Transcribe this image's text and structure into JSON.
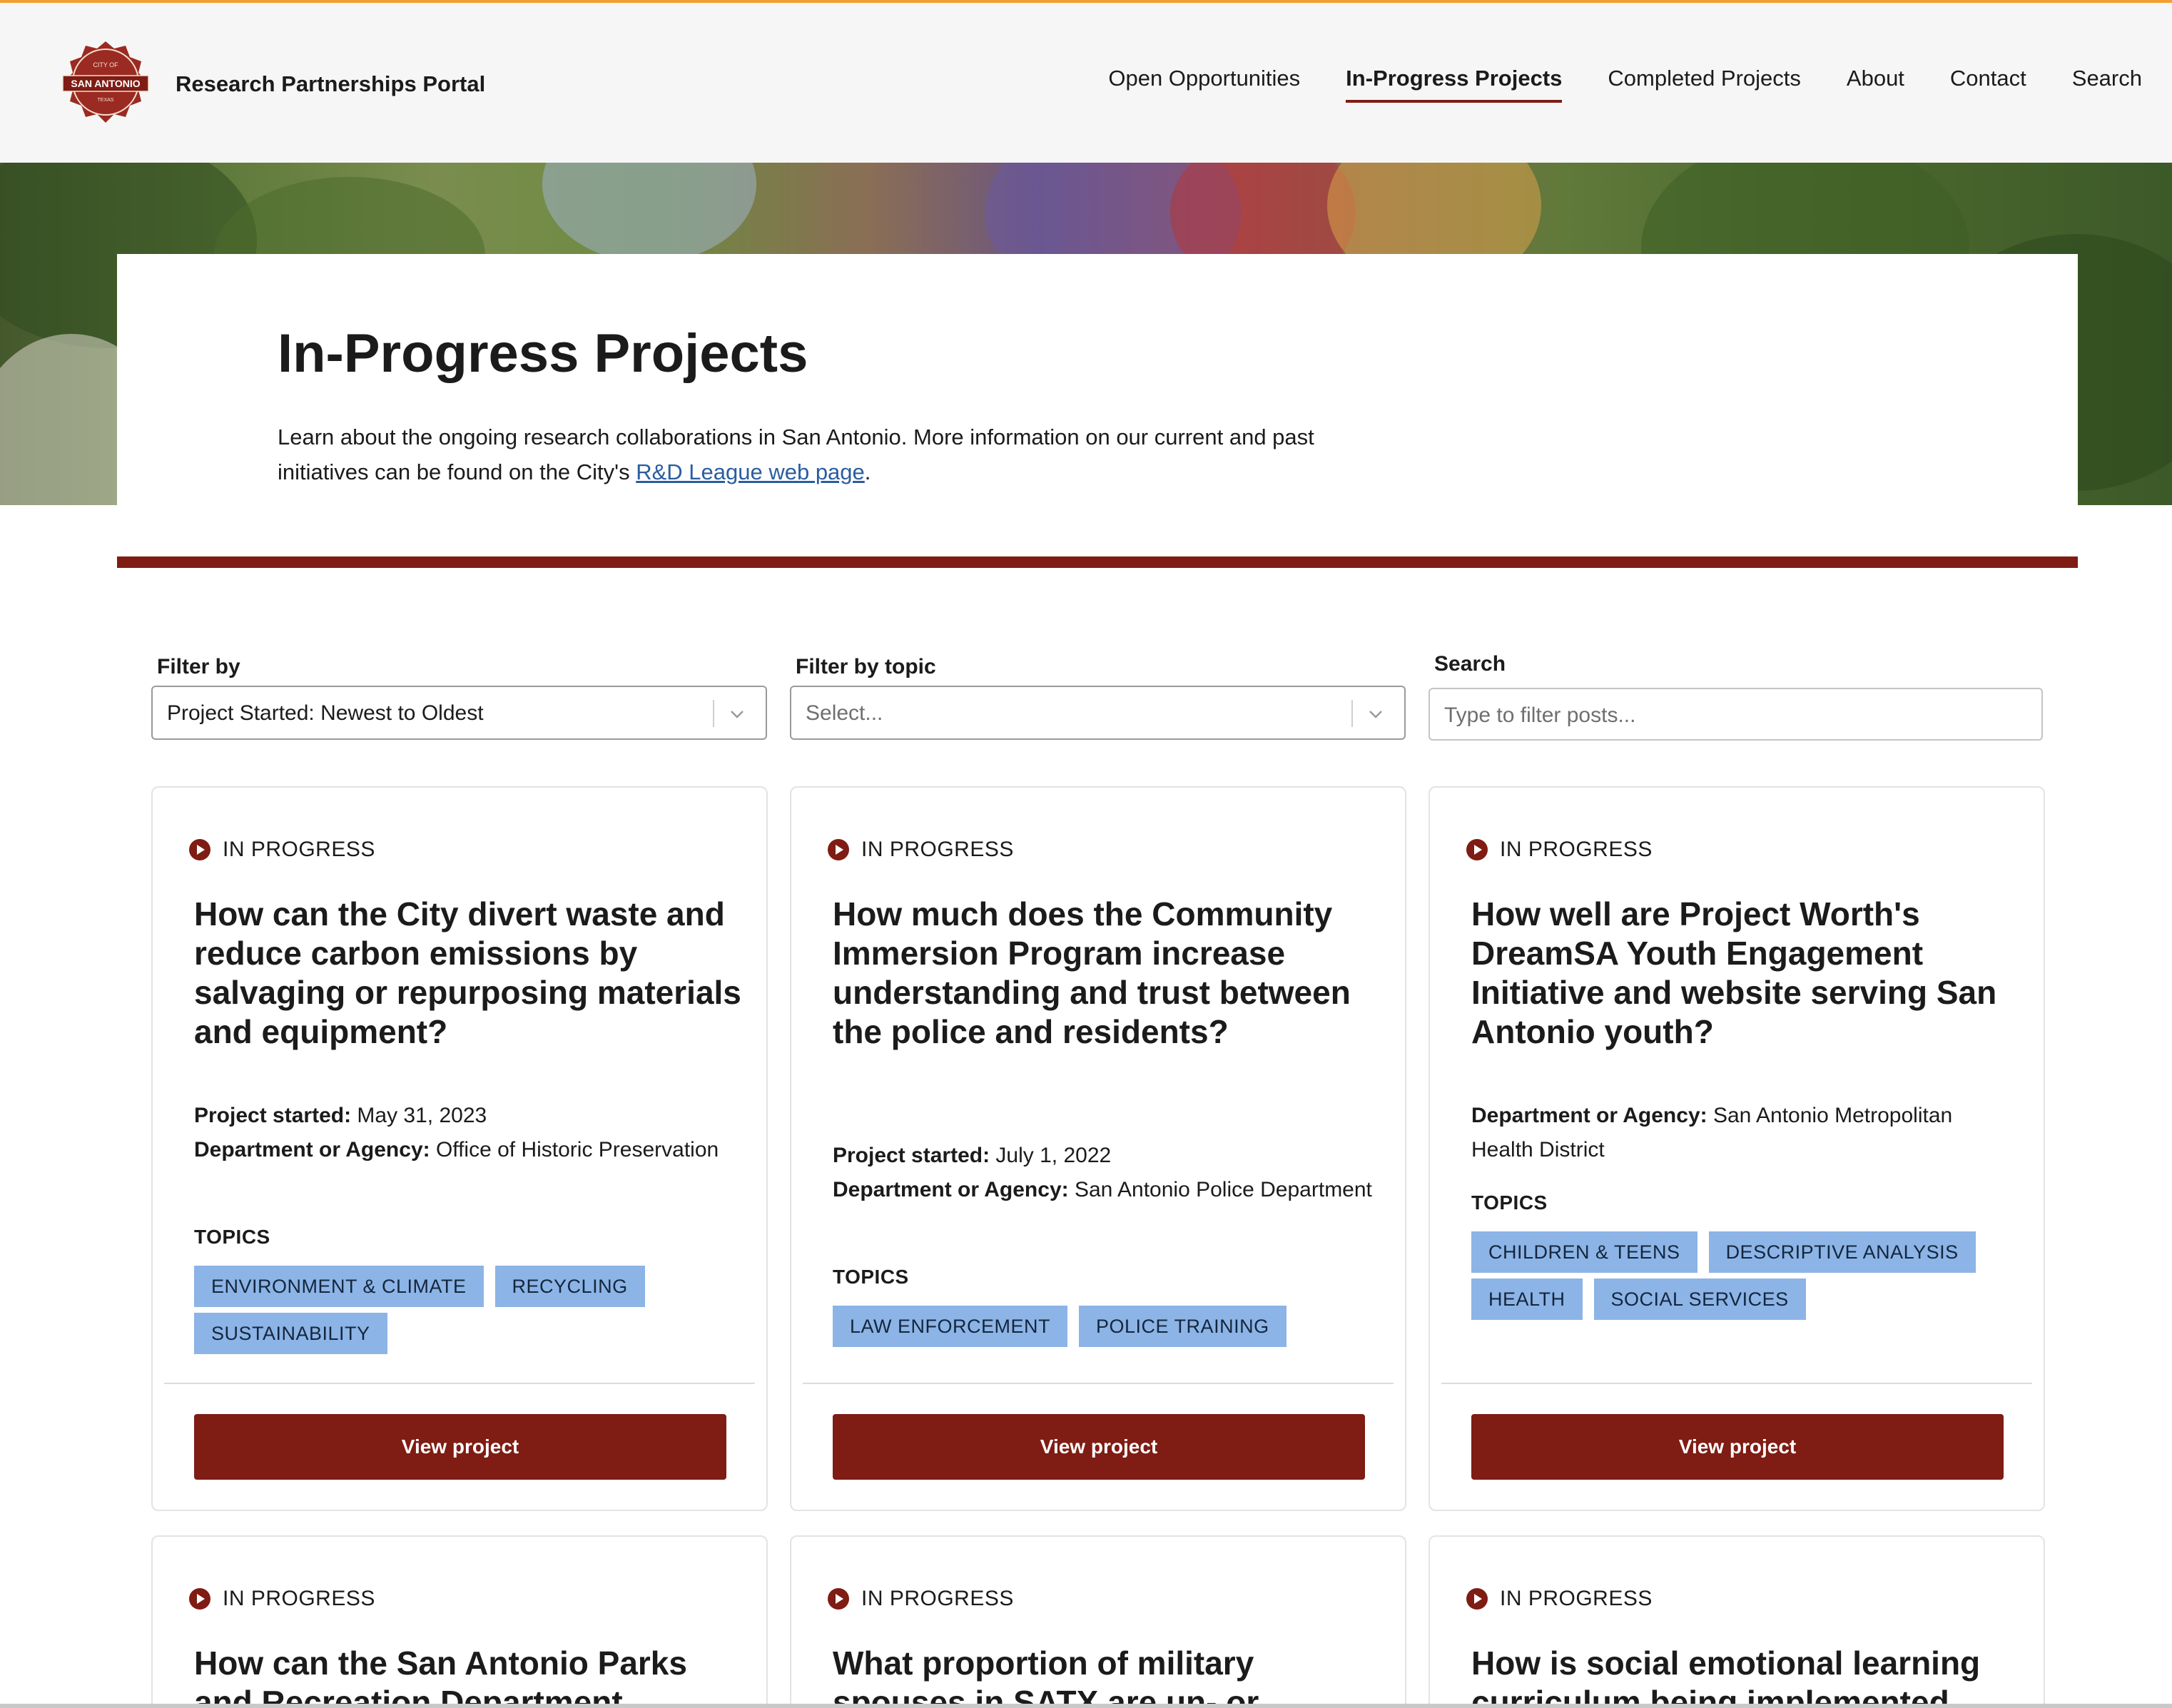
{
  "header": {
    "logo": {
      "line1": "CITY OF",
      "line2": "SAN ANTONIO",
      "line3": "TEXAS"
    },
    "site_title": "Research Partnerships Portal",
    "nav": [
      {
        "label": "Open Opportunities",
        "active": false
      },
      {
        "label": "In-Progress Projects",
        "active": true
      },
      {
        "label": "Completed Projects",
        "active": false
      },
      {
        "label": "About",
        "active": false
      },
      {
        "label": "Contact",
        "active": false
      },
      {
        "label": "Search",
        "active": false
      }
    ]
  },
  "intro": {
    "title": "In-Progress Projects",
    "text_before_link": "Learn about the ongoing research collaborations in San Antonio. More information on our current and past initiatives can be found on the City's ",
    "link_text": "R&D League web page",
    "text_after_link": "."
  },
  "filters": {
    "filter_by": {
      "label": "Filter by",
      "value": "Project Started: Newest to Oldest"
    },
    "filter_topic": {
      "label": "Filter by topic",
      "placeholder": "Select..."
    },
    "search": {
      "label": "Search",
      "placeholder": "Type to filter posts..."
    }
  },
  "cards": [
    {
      "status": "IN PROGRESS",
      "title": "How can the City divert waste and reduce carbon emissions by salvaging or repurposing materials and equipment?",
      "started_label": "Project started:",
      "started_value": " May 31, 2023",
      "dept_label": "Department or Agency:",
      "dept_value": " Office of Historic Preservation",
      "topics_label": "TOPICS",
      "tags": [
        "ENVIRONMENT & CLIMATE",
        "RECYCLING",
        "SUSTAINABILITY"
      ],
      "button": "View project"
    },
    {
      "status": "IN PROGRESS",
      "title": "How much does the Community Immersion Program increase understanding and trust between the police and residents?",
      "started_label": "Project started:",
      "started_value": " July 1, 2022",
      "dept_label": "Department or Agency:",
      "dept_value": " San Antonio Police Department",
      "topics_label": "TOPICS",
      "tags": [
        "LAW ENFORCEMENT",
        "POLICE TRAINING"
      ],
      "button": "View project"
    },
    {
      "status": "IN PROGRESS",
      "title": "How well are Project Worth's DreamSA Youth Engagement Initiative and website serving San Antonio youth?",
      "dept_label": "Department or Agency:",
      "dept_value": " San Antonio Metropolitan Health District",
      "topics_label": "TOPICS",
      "tags": [
        "CHILDREN & TEENS",
        "DESCRIPTIVE ANALYSIS",
        "HEALTH",
        "SOCIAL SERVICES"
      ],
      "button": "View project"
    },
    {
      "status": "IN PROGRESS",
      "title": "How can the San Antonio Parks and Recreation Department"
    },
    {
      "status": "IN PROGRESS",
      "title": "What proportion of military spouses in SATX are un- or"
    },
    {
      "status": "IN PROGRESS",
      "title": "How is social emotional learning curriculum being implemented"
    }
  ],
  "colors": {
    "brand": "#7f1c13",
    "tag": "#8cb4e6",
    "link": "#2a5d9f",
    "accent_top": "#f0a030"
  }
}
